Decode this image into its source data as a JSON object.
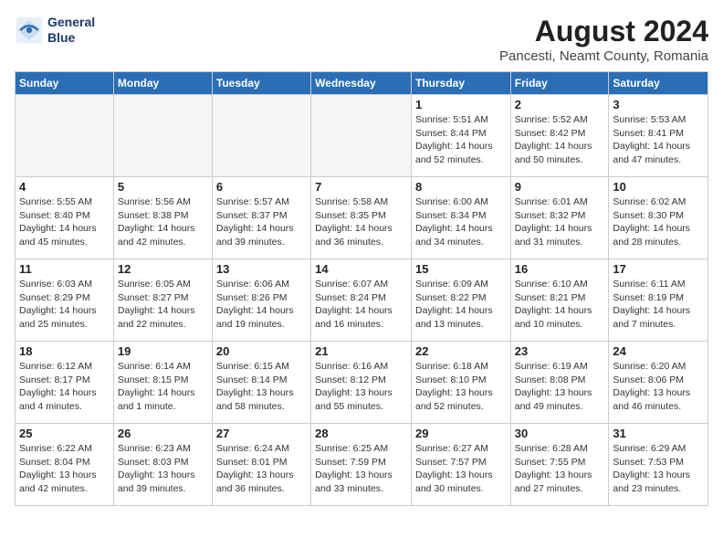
{
  "header": {
    "logo_line1": "General",
    "logo_line2": "Blue",
    "main_title": "August 2024",
    "subtitle": "Pancesti, Neamt County, Romania"
  },
  "weekdays": [
    "Sunday",
    "Monday",
    "Tuesday",
    "Wednesday",
    "Thursday",
    "Friday",
    "Saturday"
  ],
  "weeks": [
    [
      {
        "day": "",
        "info": ""
      },
      {
        "day": "",
        "info": ""
      },
      {
        "day": "",
        "info": ""
      },
      {
        "day": "",
        "info": ""
      },
      {
        "day": "1",
        "info": "Sunrise: 5:51 AM\nSunset: 8:44 PM\nDaylight: 14 hours\nand 52 minutes."
      },
      {
        "day": "2",
        "info": "Sunrise: 5:52 AM\nSunset: 8:42 PM\nDaylight: 14 hours\nand 50 minutes."
      },
      {
        "day": "3",
        "info": "Sunrise: 5:53 AM\nSunset: 8:41 PM\nDaylight: 14 hours\nand 47 minutes."
      }
    ],
    [
      {
        "day": "4",
        "info": "Sunrise: 5:55 AM\nSunset: 8:40 PM\nDaylight: 14 hours\nand 45 minutes."
      },
      {
        "day": "5",
        "info": "Sunrise: 5:56 AM\nSunset: 8:38 PM\nDaylight: 14 hours\nand 42 minutes."
      },
      {
        "day": "6",
        "info": "Sunrise: 5:57 AM\nSunset: 8:37 PM\nDaylight: 14 hours\nand 39 minutes."
      },
      {
        "day": "7",
        "info": "Sunrise: 5:58 AM\nSunset: 8:35 PM\nDaylight: 14 hours\nand 36 minutes."
      },
      {
        "day": "8",
        "info": "Sunrise: 6:00 AM\nSunset: 8:34 PM\nDaylight: 14 hours\nand 34 minutes."
      },
      {
        "day": "9",
        "info": "Sunrise: 6:01 AM\nSunset: 8:32 PM\nDaylight: 14 hours\nand 31 minutes."
      },
      {
        "day": "10",
        "info": "Sunrise: 6:02 AM\nSunset: 8:30 PM\nDaylight: 14 hours\nand 28 minutes."
      }
    ],
    [
      {
        "day": "11",
        "info": "Sunrise: 6:03 AM\nSunset: 8:29 PM\nDaylight: 14 hours\nand 25 minutes."
      },
      {
        "day": "12",
        "info": "Sunrise: 6:05 AM\nSunset: 8:27 PM\nDaylight: 14 hours\nand 22 minutes."
      },
      {
        "day": "13",
        "info": "Sunrise: 6:06 AM\nSunset: 8:26 PM\nDaylight: 14 hours\nand 19 minutes."
      },
      {
        "day": "14",
        "info": "Sunrise: 6:07 AM\nSunset: 8:24 PM\nDaylight: 14 hours\nand 16 minutes."
      },
      {
        "day": "15",
        "info": "Sunrise: 6:09 AM\nSunset: 8:22 PM\nDaylight: 14 hours\nand 13 minutes."
      },
      {
        "day": "16",
        "info": "Sunrise: 6:10 AM\nSunset: 8:21 PM\nDaylight: 14 hours\nand 10 minutes."
      },
      {
        "day": "17",
        "info": "Sunrise: 6:11 AM\nSunset: 8:19 PM\nDaylight: 14 hours\nand 7 minutes."
      }
    ],
    [
      {
        "day": "18",
        "info": "Sunrise: 6:12 AM\nSunset: 8:17 PM\nDaylight: 14 hours\nand 4 minutes."
      },
      {
        "day": "19",
        "info": "Sunrise: 6:14 AM\nSunset: 8:15 PM\nDaylight: 14 hours\nand 1 minute."
      },
      {
        "day": "20",
        "info": "Sunrise: 6:15 AM\nSunset: 8:14 PM\nDaylight: 13 hours\nand 58 minutes."
      },
      {
        "day": "21",
        "info": "Sunrise: 6:16 AM\nSunset: 8:12 PM\nDaylight: 13 hours\nand 55 minutes."
      },
      {
        "day": "22",
        "info": "Sunrise: 6:18 AM\nSunset: 8:10 PM\nDaylight: 13 hours\nand 52 minutes."
      },
      {
        "day": "23",
        "info": "Sunrise: 6:19 AM\nSunset: 8:08 PM\nDaylight: 13 hours\nand 49 minutes."
      },
      {
        "day": "24",
        "info": "Sunrise: 6:20 AM\nSunset: 8:06 PM\nDaylight: 13 hours\nand 46 minutes."
      }
    ],
    [
      {
        "day": "25",
        "info": "Sunrise: 6:22 AM\nSunset: 8:04 PM\nDaylight: 13 hours\nand 42 minutes."
      },
      {
        "day": "26",
        "info": "Sunrise: 6:23 AM\nSunset: 8:03 PM\nDaylight: 13 hours\nand 39 minutes."
      },
      {
        "day": "27",
        "info": "Sunrise: 6:24 AM\nSunset: 8:01 PM\nDaylight: 13 hours\nand 36 minutes."
      },
      {
        "day": "28",
        "info": "Sunrise: 6:25 AM\nSunset: 7:59 PM\nDaylight: 13 hours\nand 33 minutes."
      },
      {
        "day": "29",
        "info": "Sunrise: 6:27 AM\nSunset: 7:57 PM\nDaylight: 13 hours\nand 30 minutes."
      },
      {
        "day": "30",
        "info": "Sunrise: 6:28 AM\nSunset: 7:55 PM\nDaylight: 13 hours\nand 27 minutes."
      },
      {
        "day": "31",
        "info": "Sunrise: 6:29 AM\nSunset: 7:53 PM\nDaylight: 13 hours\nand 23 minutes."
      }
    ]
  ]
}
